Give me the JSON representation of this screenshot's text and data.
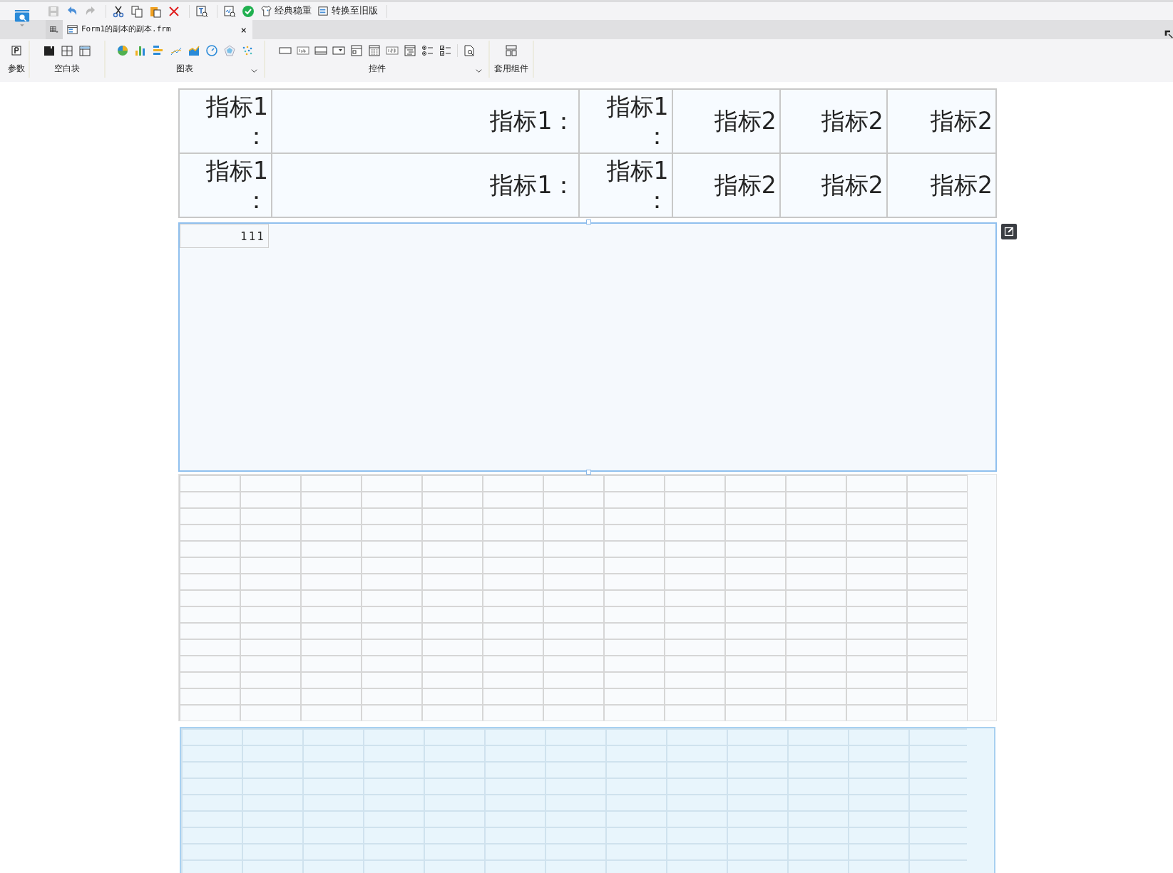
{
  "quick_toolbar": {
    "buttons": [
      {
        "label": "经典稳重"
      },
      {
        "label": "转换至旧版"
      }
    ]
  },
  "tabs": [
    {
      "label": "Form1的副本的副本.frm",
      "selected": true,
      "close": "×"
    }
  ],
  "ribbon": {
    "groups": [
      {
        "label": "参数",
        "dropdown": false
      },
      {
        "label": "空白块",
        "dropdown": false
      },
      {
        "label": "图表",
        "dropdown": true
      },
      {
        "label": "控件",
        "dropdown": true
      },
      {
        "label": "套用组件",
        "dropdown": false
      }
    ]
  },
  "report": {
    "rows": [
      [
        "指标1：",
        "指标1：",
        "指标1：",
        "指标2",
        "指标2",
        "指标2"
      ],
      [
        "指标1：",
        "指标1：",
        "指标1：",
        "指标2",
        "指标2",
        "指标2"
      ]
    ]
  },
  "block": {
    "cell": "111",
    "selected": true
  }
}
